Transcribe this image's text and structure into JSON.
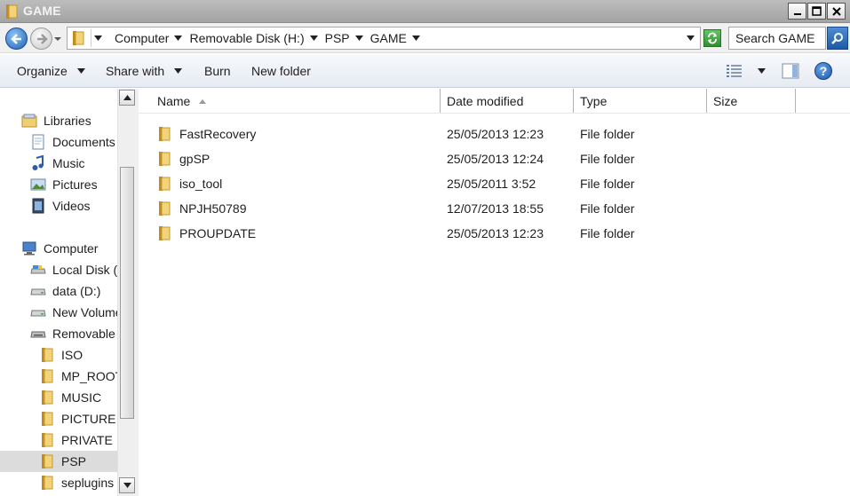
{
  "window": {
    "title": "GAME",
    "minimize_icon": "minimize-icon",
    "maximize_icon": "maximize-icon",
    "close_icon": "close-icon"
  },
  "address": {
    "crumbs": [
      "Computer",
      "Removable Disk (H:)",
      "PSP",
      "GAME"
    ],
    "search_placeholder": "Search GAME"
  },
  "toolbar": {
    "organize": "Organize",
    "share_with": "Share with",
    "burn": "Burn",
    "new_folder": "New folder"
  },
  "nav": {
    "libraries": "Libraries",
    "documents": "Documents",
    "music": "Music",
    "pictures": "Pictures",
    "videos": "Videos",
    "computer": "Computer",
    "local_disk": "Local Disk (C:)",
    "data": "data (D:)",
    "new_volume": "New Volume",
    "removable": "Removable",
    "iso": "ISO",
    "mp_root": "MP_ROOT",
    "music_folder": "MUSIC",
    "picture": "PICTURE",
    "private": "PRIVATE",
    "psp": "PSP",
    "seplugins": "seplugins"
  },
  "columns": {
    "name": "Name",
    "date_modified": "Date modified",
    "type": "Type",
    "size": "Size"
  },
  "files": [
    {
      "name": "FastRecovery",
      "date": "25/05/2013 12:23",
      "type": "File folder"
    },
    {
      "name": "gpSP",
      "date": "25/05/2013 12:24",
      "type": "File folder"
    },
    {
      "name": "iso_tool",
      "date": "25/05/2011 3:52",
      "type": "File folder"
    },
    {
      "name": "NPJH50789",
      "date": "12/07/2013 18:55",
      "type": "File folder"
    },
    {
      "name": "PROUPDATE",
      "date": "25/05/2013 12:23",
      "type": "File folder"
    }
  ],
  "colors": {
    "folder": "#e8c15a",
    "accent": "#1e5fb8",
    "selection": "#dcdcdc"
  }
}
